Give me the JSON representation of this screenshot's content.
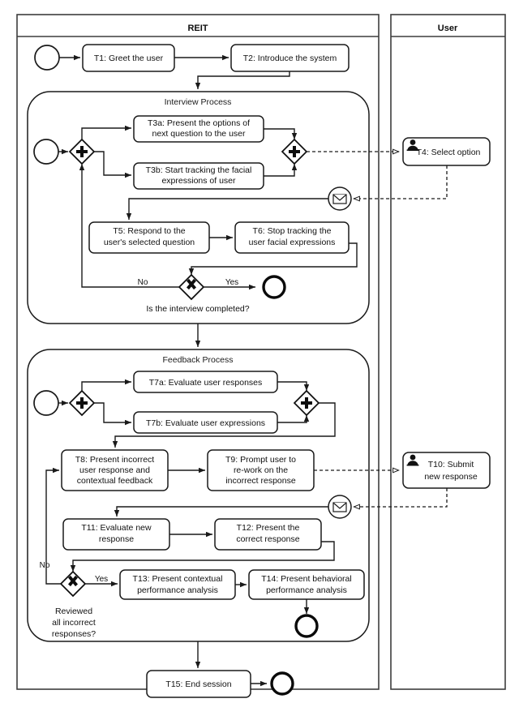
{
  "diagram": {
    "type": "bpmn-collaboration-diagram",
    "lanes": [
      {
        "id": "reit",
        "title": "REIT"
      },
      {
        "id": "user",
        "title": "User"
      }
    ],
    "subprocesses": [
      {
        "id": "interview",
        "title": "Interview Process"
      },
      {
        "id": "feedback",
        "title": "Feedback Process"
      }
    ],
    "tasks": [
      {
        "id": "t1",
        "label": "T1: Greet the user",
        "lines": [
          "T1: Greet the user"
        ],
        "lane": "reit"
      },
      {
        "id": "t2",
        "label": "T2: Introduce the system",
        "lines": [
          "T2: Introduce the system"
        ],
        "lane": "reit"
      },
      {
        "id": "t3a",
        "label": "T3a: Present the options of next question to the user",
        "lines": [
          "T3a: Present the options of",
          "next question to the user"
        ],
        "lane": "reit"
      },
      {
        "id": "t3b",
        "label": "T3b: Start tracking the facial expressions of user",
        "lines": [
          "T3b: Start tracking the facial",
          "expressions of user"
        ],
        "lane": "reit"
      },
      {
        "id": "t4",
        "label": "T4: Select option",
        "lines": [
          "T4: Select option"
        ],
        "lane": "user",
        "icon": "user-task-icon"
      },
      {
        "id": "t5",
        "label": "T5: Respond to the user's selected question",
        "lines": [
          "T5: Respond to the",
          "user's selected question"
        ],
        "lane": "reit"
      },
      {
        "id": "t6",
        "label": "T6: Stop tracking the user facial expressions",
        "lines": [
          "T6: Stop tracking the",
          "user facial expressions"
        ],
        "lane": "reit"
      },
      {
        "id": "t7a",
        "label": "T7a: Evaluate user responses",
        "lines": [
          "T7a: Evaluate user responses"
        ],
        "lane": "reit"
      },
      {
        "id": "t7b",
        "label": "T7b: Evaluate user expressions",
        "lines": [
          "T7b: Evaluate user expressions"
        ],
        "lane": "reit"
      },
      {
        "id": "t8",
        "label": "T8: Present incorrect user response and contextual feedback",
        "lines": [
          "T8: Present incorrect",
          "user response and",
          "contextual feedback"
        ],
        "lane": "reit"
      },
      {
        "id": "t9",
        "label": "T9: Prompt user to re-work on the incorrect response",
        "lines": [
          "T9: Prompt user to",
          "re-work on the",
          "incorrect response"
        ],
        "lane": "reit"
      },
      {
        "id": "t10",
        "label": "T10: Submit new response",
        "lines": [
          "T10: Submit",
          "new response"
        ],
        "lane": "user",
        "icon": "user-task-icon"
      },
      {
        "id": "t11",
        "label": "T11: Evaluate new response",
        "lines": [
          "T11: Evaluate new",
          "response"
        ],
        "lane": "reit"
      },
      {
        "id": "t12",
        "label": "T12: Present the correct response",
        "lines": [
          "T12: Present the",
          "correct response"
        ],
        "lane": "reit"
      },
      {
        "id": "t13",
        "label": "T13: Present contextual performance analysis",
        "lines": [
          "T13: Present contextual",
          "performance analysis"
        ],
        "lane": "reit"
      },
      {
        "id": "t14",
        "label": "T14: Present behavioral performance analysis",
        "lines": [
          "T14: Present behavioral",
          "performance analysis"
        ],
        "lane": "reit"
      },
      {
        "id": "t15",
        "label": "T15: End session",
        "lines": [
          "T15: End session"
        ],
        "lane": "reit"
      }
    ],
    "gateways": [
      {
        "id": "g-int-split",
        "kind": "parallel",
        "icon": "parallel-gateway-icon"
      },
      {
        "id": "g-int-join",
        "kind": "parallel",
        "icon": "parallel-gateway-icon"
      },
      {
        "id": "g-int-dec",
        "kind": "exclusive",
        "icon": "exclusive-gateway-icon",
        "question": "Is the interview completed?",
        "outcomes": [
          "No",
          "Yes"
        ]
      },
      {
        "id": "g-fb-split",
        "kind": "parallel",
        "icon": "parallel-gateway-icon"
      },
      {
        "id": "g-fb-join",
        "kind": "parallel",
        "icon": "parallel-gateway-icon"
      },
      {
        "id": "g-fb-dec",
        "kind": "exclusive",
        "icon": "exclusive-gateway-icon",
        "question": "Reviewed all incorrect responses?",
        "question_lines": [
          "Reviewed",
          "all incorrect",
          "responses?"
        ],
        "outcomes": [
          "No",
          "Yes"
        ]
      }
    ],
    "events": [
      {
        "id": "ev-start-main",
        "kind": "start",
        "icon": "start-event-icon"
      },
      {
        "id": "ev-start-int",
        "kind": "start",
        "icon": "start-event-icon"
      },
      {
        "id": "ev-msg-int",
        "kind": "message-catch",
        "icon": "message-event-icon"
      },
      {
        "id": "ev-end-int",
        "kind": "end",
        "icon": "end-event-icon"
      },
      {
        "id": "ev-start-fb",
        "kind": "start",
        "icon": "start-event-icon"
      },
      {
        "id": "ev-msg-fb",
        "kind": "message-catch",
        "icon": "message-event-icon"
      },
      {
        "id": "ev-end-fb",
        "kind": "end",
        "icon": "end-event-icon"
      },
      {
        "id": "ev-end-main",
        "kind": "end",
        "icon": "end-event-icon"
      }
    ],
    "edge_labels": {
      "interview_no": "No",
      "interview_yes": "Yes",
      "feedback_no": "No",
      "feedback_yes": "Yes"
    },
    "conditions": {
      "interview_question": "Is the interview completed?",
      "feedback_question_l1": "Reviewed",
      "feedback_question_l2": "all incorrect",
      "feedback_question_l3": "responses?"
    },
    "colors": {
      "stroke": "#1a1a1a",
      "lane_stroke": "#3d3d3d",
      "background": "#ffffff",
      "text": "#111111"
    }
  }
}
